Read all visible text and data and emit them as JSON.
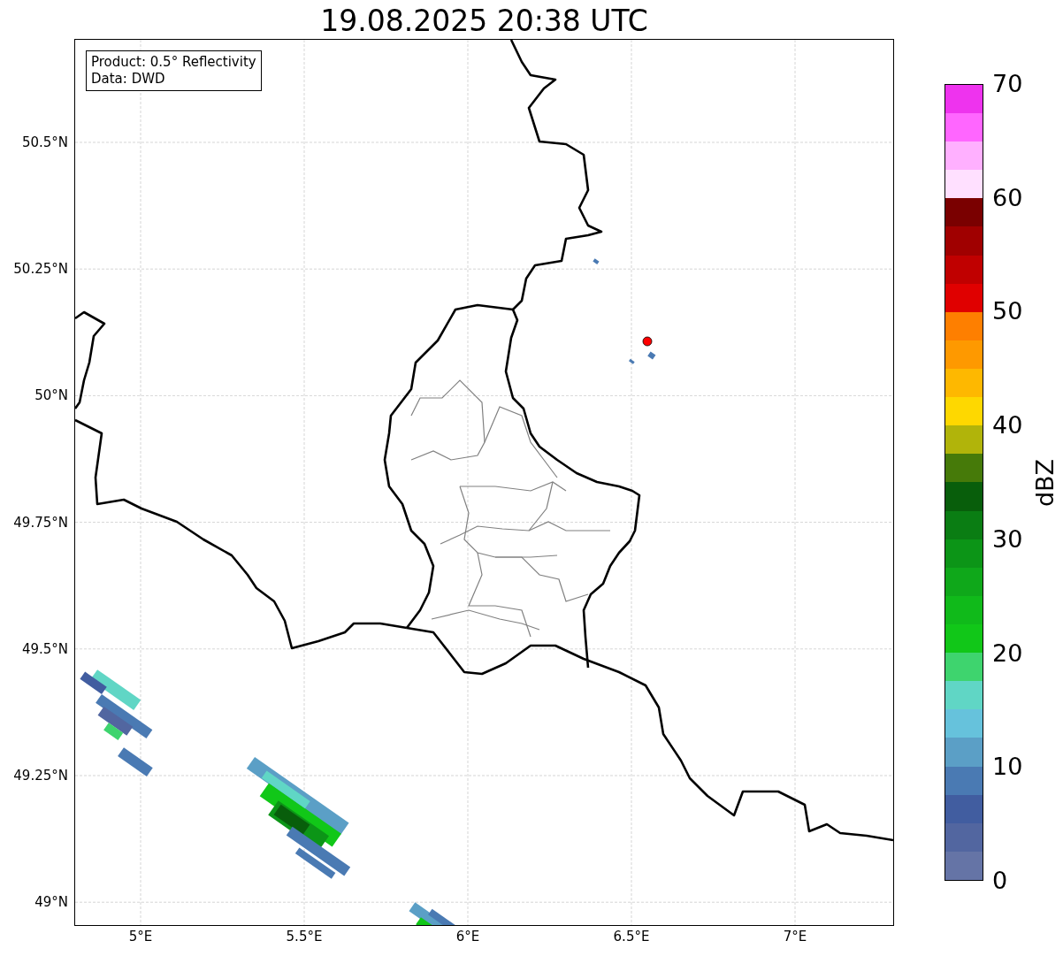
{
  "title": "19.08.2025 20:38 UTC",
  "info_box": [
    "Product: 0.5° Reflectivity",
    "Data: DWD"
  ],
  "map": {
    "lat_labels": [
      "50.5°N",
      "50.25°N",
      "50°N",
      "49.75°N",
      "49.5°N",
      "49.25°N",
      "49°N"
    ],
    "lon_labels": [
      "5°E",
      "5.5°E",
      "6°E",
      "6.5°E",
      "7°E"
    ]
  },
  "colorbar": {
    "label": "dBZ",
    "ticks": [
      "70",
      "60",
      "50",
      "40",
      "30",
      "20",
      "10",
      "0"
    ],
    "segments": [
      {
        "color": "#6574a6"
      },
      {
        "color": "#5266a0"
      },
      {
        "color": "#415da0"
      },
      {
        "color": "#4a7ab3"
      },
      {
        "color": "#5b9fc6"
      },
      {
        "color": "#66c2dc"
      },
      {
        "color": "#60d6c5"
      },
      {
        "color": "#3ed46e"
      },
      {
        "color": "#11c718"
      },
      {
        "color": "#10ba1a"
      },
      {
        "color": "#0fa81a"
      },
      {
        "color": "#0c9517"
      },
      {
        "color": "#0a7d13"
      },
      {
        "color": "#085e0b"
      },
      {
        "color": "#467a09"
      },
      {
        "color": "#b1b40a"
      },
      {
        "color": "#fed800"
      },
      {
        "color": "#feb800"
      },
      {
        "color": "#fe9900"
      },
      {
        "color": "#fe7f00"
      },
      {
        "color": "#e00000"
      },
      {
        "color": "#c00000"
      },
      {
        "color": "#a00000"
      },
      {
        "color": "#7a0000"
      },
      {
        "color": "#ffe0ff"
      },
      {
        "color": "#ffb0ff"
      },
      {
        "color": "#ff66ff"
      },
      {
        "color": "#ee33ee"
      }
    ]
  }
}
